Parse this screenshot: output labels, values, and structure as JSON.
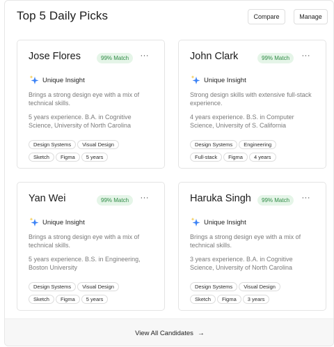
{
  "header": {
    "title": "Top 5 Daily Picks",
    "compare_label": "Compare",
    "manage_label": "Manage"
  },
  "cards": [
    {
      "name": "Jose Flores",
      "match": "99% Match",
      "more": "···",
      "insight_label": "Unique Insight",
      "insight_icon": "sparkle-icon",
      "desc1": "Brings a strong design eye with a mix of technical skills.",
      "desc2": "5 years experience. B.A. in Cognitive Science, University of North Carolina",
      "tags": [
        "Design Systems",
        "Visual Design",
        "Sketch",
        "Figma",
        "5 years"
      ]
    },
    {
      "name": "John Clark",
      "match": "99% Match",
      "more": "···",
      "insight_label": "Unique Insight",
      "insight_icon": "sparkle-icon",
      "desc1": "Strong design skills with extensive full-stack experience.",
      "desc2": "4 years experience. B.S. in Computer Science, University of S. California",
      "tags": [
        "Design Systems",
        "Engineering",
        "Full-stack",
        "Figma",
        "4 years"
      ]
    },
    {
      "name": "Yan Wei",
      "match": "99% Match",
      "more": "···",
      "insight_label": "Unique Insight",
      "insight_icon": "sparkle-icon",
      "desc1": "Brings a strong design eye with a mix of technical skills.",
      "desc2": "5 years experience. B.S. in Engineering, Boston University",
      "tags": [
        "Design Systems",
        "Visual Design",
        "Sketch",
        "Figma",
        "5 years"
      ]
    },
    {
      "name": "Haruka Singh",
      "match": "99% Match",
      "more": "···",
      "insight_label": "Unique Insight",
      "insight_icon": "sparkle-icon",
      "desc1": "Brings a strong design eye with a mix of technical skills.",
      "desc2": "3 years experience. B.A. in Cognitive Science, University of North Carolina",
      "tags": [
        "Design Systems",
        "Visual Design",
        "Sketch",
        "Figma",
        "3 years"
      ]
    }
  ],
  "footer": {
    "link_label": "View All Candidates",
    "arrow": "→"
  },
  "colors": {
    "match_bg": "#e5f5e8",
    "match_text": "#2e8a44",
    "sparkle_blue": "#3b82f6",
    "sparkle_yellow": "#f2c94c"
  }
}
